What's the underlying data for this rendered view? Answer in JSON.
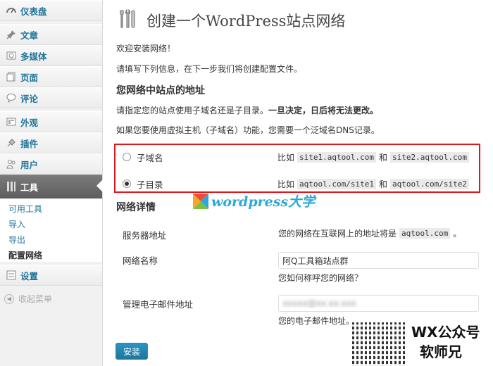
{
  "sidebar": {
    "items": [
      {
        "label": "仪表盘",
        "icon": "dashboard-icon"
      },
      {
        "label": "文章",
        "icon": "pin-icon"
      },
      {
        "label": "多媒体",
        "icon": "media-icon"
      },
      {
        "label": "页面",
        "icon": "page-icon"
      },
      {
        "label": "评论",
        "icon": "comment-icon"
      },
      {
        "label": "外观",
        "icon": "appearance-icon"
      },
      {
        "label": "插件",
        "icon": "plugin-icon"
      },
      {
        "label": "用户",
        "icon": "users-icon"
      },
      {
        "label": "工具",
        "icon": "tools-icon"
      },
      {
        "label": "设置",
        "icon": "settings-icon"
      }
    ],
    "submenu": [
      "可用工具",
      "导入",
      "导出",
      "配置网络"
    ],
    "collapse_label": "收起菜单"
  },
  "main": {
    "title": "创建一个WordPress站点网络",
    "welcome": "欢迎安装网络！",
    "instructions": "请填写下列信息，在下一步我们将创建配置文件。",
    "section_title": "您网络中站点的地址",
    "choose_text": "请指定您的站点使用子域名还是子目录。",
    "choose_warning": "一旦决定，日后将无法更改。",
    "vhost_note": "如果您要使用虚拟主机（子域名）功能，您需要一个泛域名DNS记录。",
    "options": [
      {
        "label": "子域名",
        "checked": false,
        "example_prefix": "比如",
        "code1": "site1.aqtool.com",
        "join": "和",
        "code2": "site2.aqtool.com"
      },
      {
        "label": "子目录",
        "checked": true,
        "example_prefix": "比如",
        "code1": "aqtool.com/site1",
        "join": "和",
        "code2": "aqtool.com/site2"
      }
    ],
    "details_title": "网络详情",
    "server_address_label": "服务器地址",
    "server_address_text": "您的网络在互联网上的地址将是",
    "server_address_code": "aqtool.com",
    "server_address_suffix": "。",
    "network_name_label": "网络名称",
    "network_name_value": "阿Q工具箱站点群",
    "network_name_hint": "您如何称呼您的网络？",
    "admin_email_label": "管理电子邮件地址",
    "admin_email_value": "xxxxx@xx.xx.xxx",
    "admin_email_hint": "您的电子邮件地址。",
    "install_button": "安装"
  },
  "watermark": {
    "site_logo_text": "wordpress大学",
    "wechat_line1": "WX公众号",
    "wechat_line2": "软师兄"
  },
  "colors": {
    "link": "#21759b",
    "highlight_border": "#e0161c",
    "button": "#21759b"
  }
}
